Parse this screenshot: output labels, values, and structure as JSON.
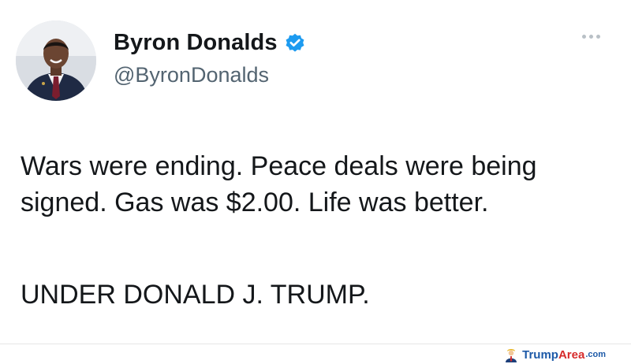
{
  "tweet": {
    "author": {
      "display_name": "Byron Donalds",
      "handle": "@ByronDonalds",
      "avatar_icon": "profile-photo",
      "verified_icon": "verified-badge-icon",
      "verified_color": "#1d9bf0"
    },
    "more_icon": "more-options-icon",
    "text_line_1": "Wars were ending. Peace deals were being\nsigned. Gas was $2.00. Life was better.",
    "text_line_2": "UNDER DONALD J. TRUMP."
  },
  "watermark": {
    "part_1": "Trump",
    "part_2": "Area",
    "part_3": ".com",
    "icon": "trump-figure-icon"
  }
}
